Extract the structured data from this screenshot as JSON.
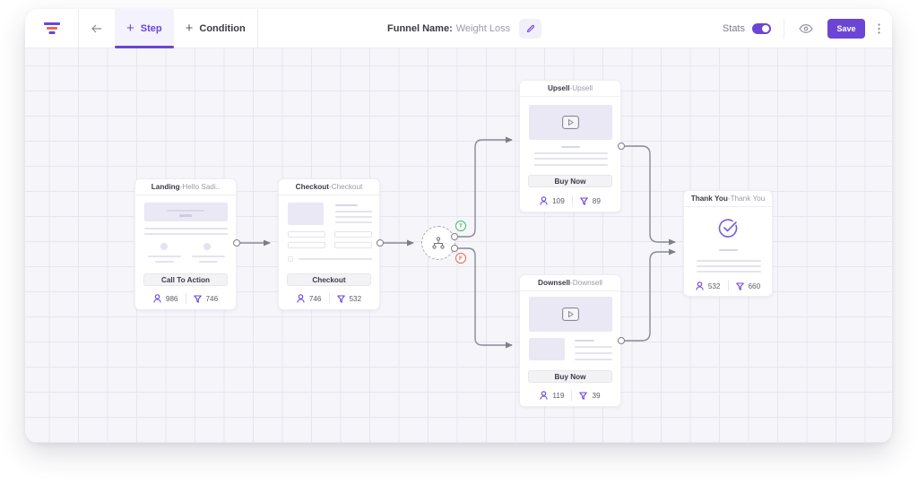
{
  "header": {
    "logo_icon": "funnel-logo-icon",
    "back_icon": "arrow-left-icon",
    "tabs": [
      {
        "label": "Step",
        "icon": "plus-icon",
        "active": true
      },
      {
        "label": "Condition",
        "icon": "plus-icon",
        "active": false
      }
    ],
    "funnel_name_label": "Funnel Name:",
    "funnel_name_value": "Weight Loss",
    "edit_icon": "pencil-icon",
    "stats_label": "Stats",
    "stats_enabled": true,
    "preview_icon": "eye-icon",
    "save_label": "Save",
    "more_icon": "more-vertical-icon"
  },
  "colors": {
    "accent": "#6b46d6",
    "logo_orange": "#ef6a4a",
    "true_branch": "#3dbb6a",
    "false_branch": "#e5674a",
    "canvas": "#f5f5fa"
  },
  "nodes": {
    "landing": {
      "type": "Landing",
      "name": "Hello Sadi..",
      "button": "Call To Action",
      "visitors": "986",
      "conversions": "746"
    },
    "checkout": {
      "type": "Checkout",
      "name": "Checkout",
      "button": "Checkout",
      "visitors": "746",
      "conversions": "532"
    },
    "condition": {
      "icon": "branch-icon",
      "true_label": "T",
      "false_label": "F"
    },
    "upsell": {
      "type": "Upsell",
      "name": "Upsell",
      "button": "Buy Now",
      "visitors": "109",
      "conversions": "89"
    },
    "downsell": {
      "type": "Downsell",
      "name": "Downsell",
      "button": "Buy Now",
      "visitors": "119",
      "conversions": "39"
    },
    "thankyou": {
      "type": "Thank You",
      "name": "Thank You",
      "visitors": "532",
      "conversions": "660"
    }
  },
  "separator": " - "
}
